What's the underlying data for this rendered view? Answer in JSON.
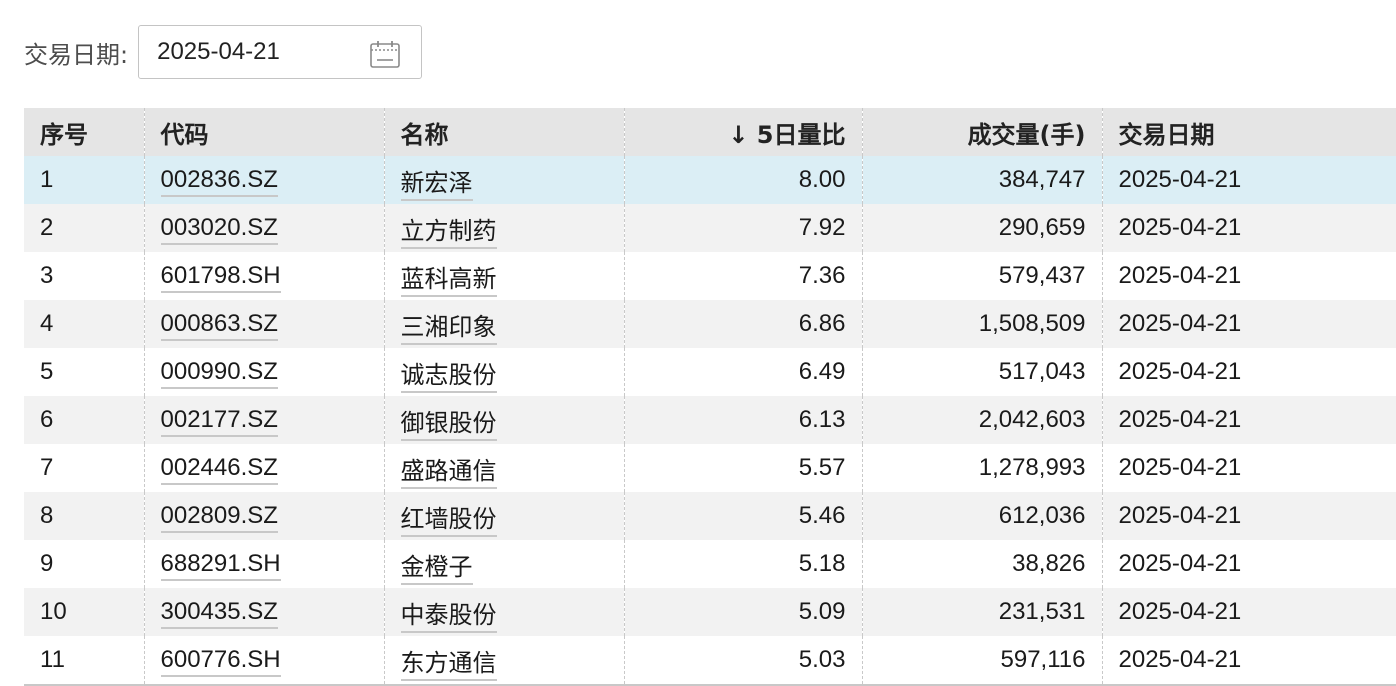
{
  "filter": {
    "label": "交易日期:",
    "date": "2025-04-21"
  },
  "columns": [
    {
      "key": "no",
      "label": "序号"
    },
    {
      "key": "code",
      "label": "代码"
    },
    {
      "key": "name",
      "label": "名称"
    },
    {
      "key": "ratio",
      "label": "↓ 5日量比"
    },
    {
      "key": "volume",
      "label": "成交量(手)"
    },
    {
      "key": "date",
      "label": "交易日期"
    }
  ],
  "rows": [
    {
      "no": "1",
      "code": "002836.SZ",
      "name": "新宏泽",
      "ratio": "8.00",
      "volume": "384,747",
      "date": "2025-04-21"
    },
    {
      "no": "2",
      "code": "003020.SZ",
      "name": "立方制药",
      "ratio": "7.92",
      "volume": "290,659",
      "date": "2025-04-21"
    },
    {
      "no": "3",
      "code": "601798.SH",
      "name": "蓝科高新",
      "ratio": "7.36",
      "volume": "579,437",
      "date": "2025-04-21"
    },
    {
      "no": "4",
      "code": "000863.SZ",
      "name": "三湘印象",
      "ratio": "6.86",
      "volume": "1,508,509",
      "date": "2025-04-21"
    },
    {
      "no": "5",
      "code": "000990.SZ",
      "name": "诚志股份",
      "ratio": "6.49",
      "volume": "517,043",
      "date": "2025-04-21"
    },
    {
      "no": "6",
      "code": "002177.SZ",
      "name": "御银股份",
      "ratio": "6.13",
      "volume": "2,042,603",
      "date": "2025-04-21"
    },
    {
      "no": "7",
      "code": "002446.SZ",
      "name": "盛路通信",
      "ratio": "5.57",
      "volume": "1,278,993",
      "date": "2025-04-21"
    },
    {
      "no": "8",
      "code": "002809.SZ",
      "name": "红墙股份",
      "ratio": "5.46",
      "volume": "612,036",
      "date": "2025-04-21"
    },
    {
      "no": "9",
      "code": "688291.SH",
      "name": "金橙子",
      "ratio": "5.18",
      "volume": "38,826",
      "date": "2025-04-21"
    },
    {
      "no": "10",
      "code": "300435.SZ",
      "name": "中泰股份",
      "ratio": "5.09",
      "volume": "231,531",
      "date": "2025-04-21"
    },
    {
      "no": "11",
      "code": "600776.SH",
      "name": "东方通信",
      "ratio": "5.03",
      "volume": "597,116",
      "date": "2025-04-21"
    }
  ]
}
